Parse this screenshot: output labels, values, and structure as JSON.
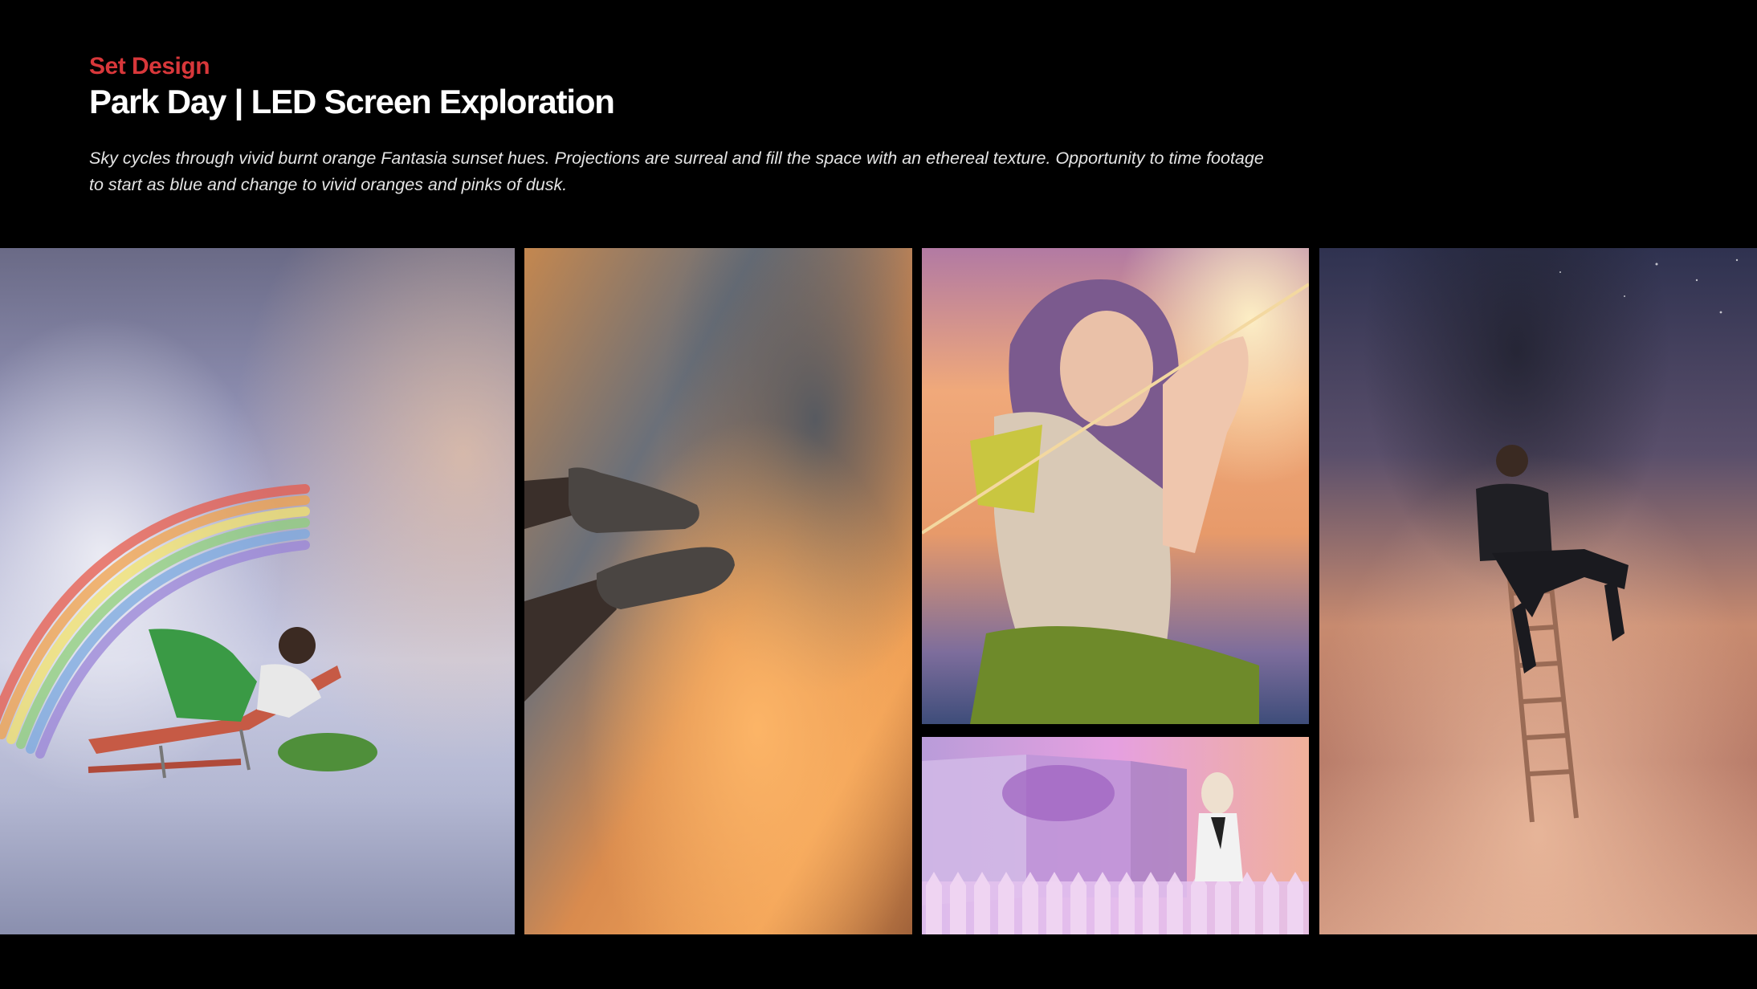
{
  "slide": {
    "eyebrow": "Set Design",
    "title": "Park Day | LED Screen Exploration",
    "description": "Sky cycles through vivid burnt orange Fantasia sunset hues. Projections are surreal and fill the space with an ethereal texture. Opportunity to time footage to start as blue and change to vivid oranges and pinks of dusk."
  },
  "colors": {
    "background": "#000000",
    "eyebrow": "#d8373a",
    "title": "#ffffff",
    "description": "#e4e4e4"
  },
  "photos": [
    {
      "id": "rainbow",
      "subject": "man-lounging-on-chair-in-clouds-with-rainbow"
    },
    {
      "id": "feet",
      "subject": "sneakers-against-orange-cloudy-sky"
    },
    {
      "id": "archer",
      "subject": "woman-with-bow-against-sunset-sky"
    },
    {
      "id": "stage",
      "subject": "performer-on-stage-with-pink-cloud-led-backdrop"
    },
    {
      "id": "ladder",
      "subject": "man-sitting-on-ladder-above-clouds"
    }
  ]
}
